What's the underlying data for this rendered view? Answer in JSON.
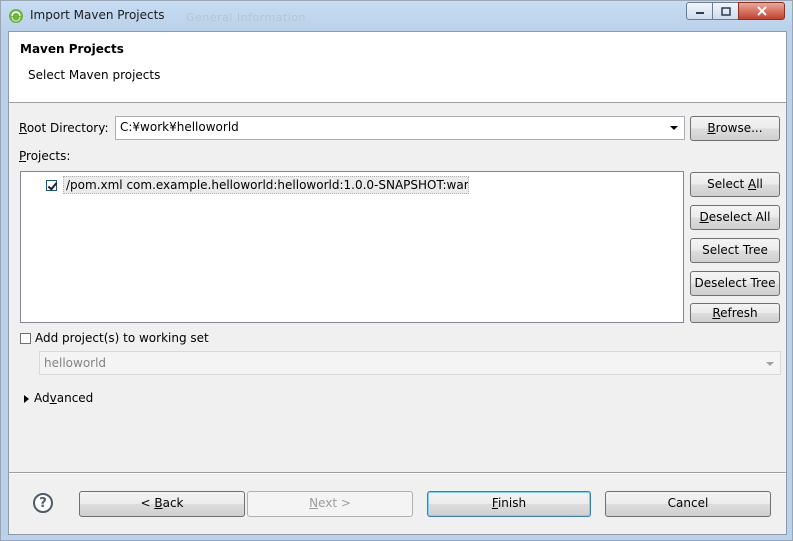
{
  "window": {
    "title": "Import Maven Projects",
    "ghost_title": "General Information",
    "controls": {
      "minimize": "—",
      "maximize": "□",
      "close": "✕"
    }
  },
  "header": {
    "title": "Maven Projects",
    "description": "Select Maven projects"
  },
  "root_directory": {
    "label_prefix": "R",
    "label_rest": "oot Directory:",
    "value": "C:¥work¥helloworld",
    "browse_label_prefix": "B",
    "browse_label_rest": "rowse..."
  },
  "projects": {
    "label_prefix": "P",
    "label_rest": "rojects:",
    "items": [
      {
        "checked": true,
        "text": "/pom.xml  com.example.helloworld:helloworld:1.0.0-SNAPSHOT:war"
      }
    ]
  },
  "side_buttons": {
    "select_all_pre": "Select ",
    "select_all_ul": "A",
    "select_all_post": "ll",
    "deselect_all_ul": "D",
    "deselect_all_post": "eselect All",
    "select_tree": "Select Tree",
    "deselect_tree": "Deselect Tree",
    "refresh_ul": "R",
    "refresh_post": "efresh"
  },
  "working_set": {
    "checkbox_label": "Add project(s) to working set",
    "checked": false,
    "value": "helloworld"
  },
  "advanced": {
    "label_pre": "Ad",
    "label_ul": "v",
    "label_post": "anced"
  },
  "footer": {
    "help": "?",
    "back_pre": "< ",
    "back_ul": "B",
    "back_post": "ack",
    "next_ul": "N",
    "next_post": "ext >",
    "finish_ul": "F",
    "finish_post": "inish",
    "cancel": "Cancel"
  },
  "colors": {
    "titlebar": "#b9d1ea",
    "dialog_bg": "#f0f0f0",
    "close_button": "#c2412d"
  }
}
